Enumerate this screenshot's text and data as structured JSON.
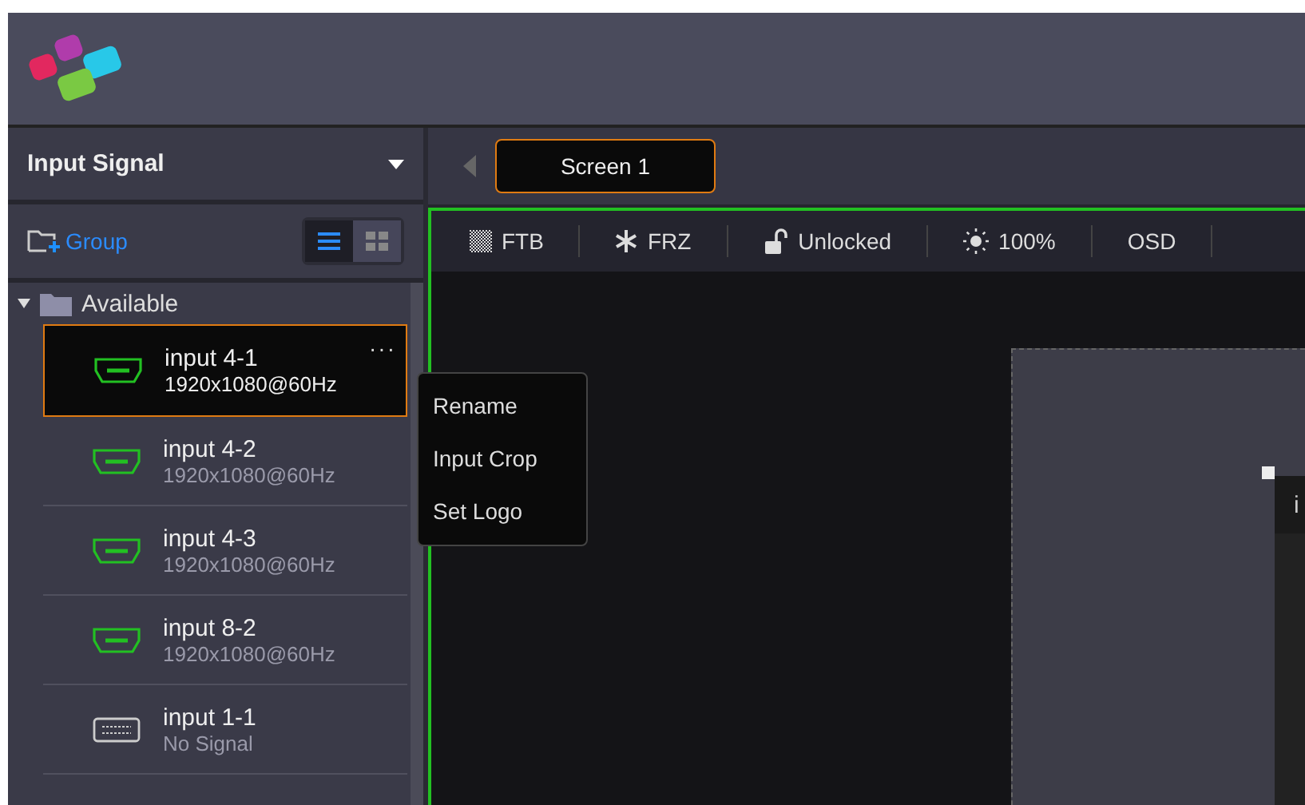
{
  "sidebar": {
    "title": "Input Signal",
    "group_button": "Group",
    "views": [
      {
        "kind": "list",
        "selected": true
      },
      {
        "kind": "grid",
        "selected": false
      }
    ],
    "folder": {
      "label": "Available",
      "expanded": true
    },
    "inputs": [
      {
        "name": "input 4-1",
        "info": "1920x1080@60Hz",
        "kind": "hdmi",
        "selected": true,
        "more": "···"
      },
      {
        "name": "input 4-2",
        "info": "1920x1080@60Hz",
        "kind": "hdmi",
        "selected": false
      },
      {
        "name": "input 4-3",
        "info": "1920x1080@60Hz",
        "kind": "hdmi",
        "selected": false
      },
      {
        "name": "input 8-2",
        "info": "1920x1080@60Hz",
        "kind": "hdmi",
        "selected": false
      },
      {
        "name": "input 1-1",
        "info": "No Signal",
        "kind": "dvi",
        "selected": false
      }
    ]
  },
  "context_menu": [
    "Rename",
    "Input Crop",
    "Set Logo"
  ],
  "screen_tabs": [
    {
      "label": "Screen 1",
      "selected": true
    }
  ],
  "toolbar": [
    {
      "kind": "ftb",
      "label": "FTB"
    },
    {
      "kind": "frz",
      "label": "FRZ"
    },
    {
      "kind": "lock",
      "label": "Unlocked"
    },
    {
      "kind": "brightness",
      "label": "100%"
    },
    {
      "kind": "text",
      "label": "OSD"
    }
  ],
  "layer": {
    "title": "i"
  }
}
